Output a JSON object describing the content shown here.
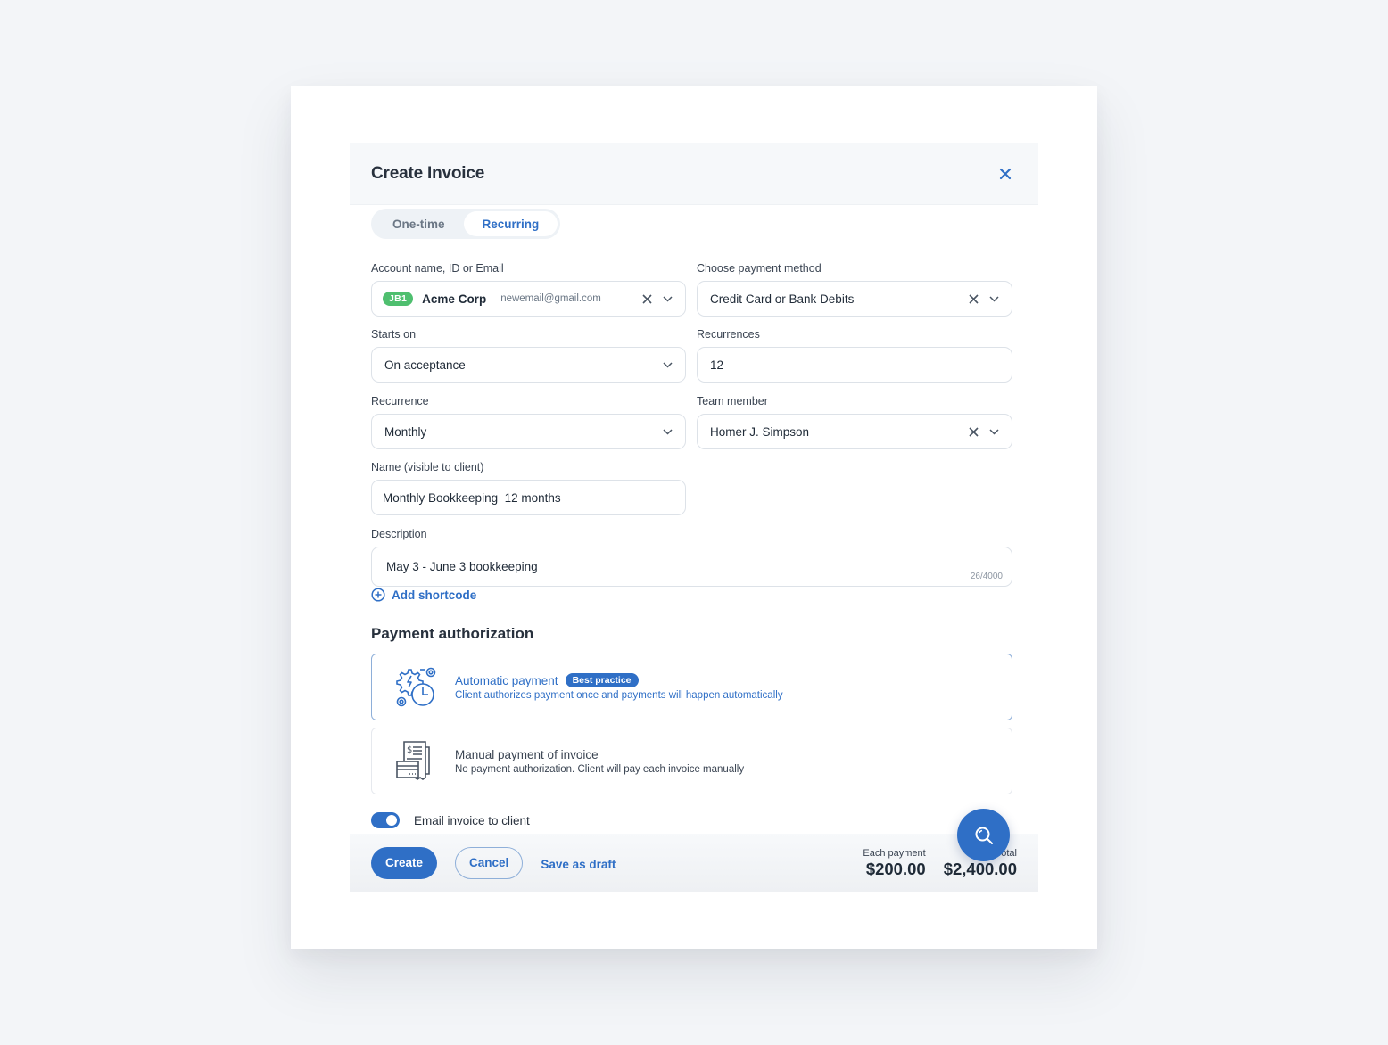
{
  "modal": {
    "title": "Create Invoice",
    "close_icon": "close-icon"
  },
  "tabs": [
    {
      "label": "One-time",
      "active": false
    },
    {
      "label": "Recurring",
      "active": true
    }
  ],
  "fields": {
    "account": {
      "label": "Account name, ID or Email",
      "badge": "JB1",
      "name": "Acme Corp",
      "email": "newemail@gmail.com"
    },
    "payment_method": {
      "label": "Choose payment method",
      "value": "Credit Card or Bank Debits"
    },
    "starts_on": {
      "label": "Starts on",
      "value": "On acceptance"
    },
    "recurrences": {
      "label": "Recurrences",
      "value": "12"
    },
    "recurrence": {
      "label": "Recurrence",
      "value": "Monthly"
    },
    "team_member": {
      "label": "Team member",
      "value": "Homer J. Simpson"
    },
    "name": {
      "label": "Name (visible to client)",
      "value": "Monthly Bookkeeping  12 months"
    },
    "description": {
      "label": "Description",
      "value": "May 3 - June 3 bookkeeping",
      "counter": "26/4000"
    }
  },
  "add_shortcode": "Add shortcode",
  "payment_authorization": {
    "title": "Payment authorization",
    "options": [
      {
        "title": "Automatic payment",
        "badge": "Best practice",
        "subtitle": "Client authorizes payment once and payments will happen automatically",
        "icon": "automation-gear-clock-icon",
        "selected": true
      },
      {
        "title": "Manual payment of invoice",
        "subtitle": "No payment authorization. Client will pay each invoice manually",
        "icon": "invoice-card-icon",
        "selected": false
      }
    ]
  },
  "email_toggle": {
    "label": "Email invoice to client",
    "on": true
  },
  "footer": {
    "create_label": "Create",
    "cancel_label": "Cancel",
    "draft_label": "Save as draft",
    "each_payment_label": "Each payment",
    "each_payment_value": "$200.00",
    "total_label": "Total",
    "total_value": "$2,400.00"
  },
  "colors": {
    "accent": "#2f6fc6",
    "badge_green": "#4fbf6f",
    "background": "#f3f5f8"
  }
}
